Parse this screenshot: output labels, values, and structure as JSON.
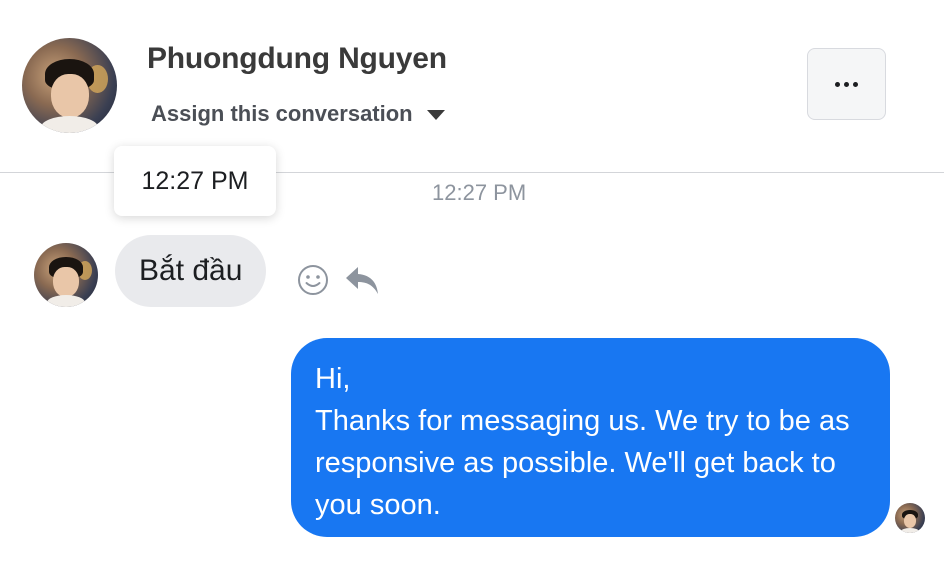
{
  "header": {
    "contact_name": "Phuongdung Nguyen",
    "assign_label": "Assign this conversation",
    "more_icon": "more-horizontal-icon",
    "avatar_icon": "profile-photo"
  },
  "conversation": {
    "tooltip_time": "12:27 PM",
    "divider_time": "12:27 PM",
    "incoming": {
      "text": "Bắt đầu",
      "react_icon": "smiley-icon",
      "reply_icon": "reply-arrow-icon"
    },
    "outgoing": {
      "text": "Hi,\n Thanks for messaging us. We try to be as responsive as possible. We'll get back to you soon."
    }
  },
  "colors": {
    "outgoing_bubble": "#1877f2",
    "incoming_bubble": "#e9eaed",
    "timestamp": "#8d949e"
  }
}
